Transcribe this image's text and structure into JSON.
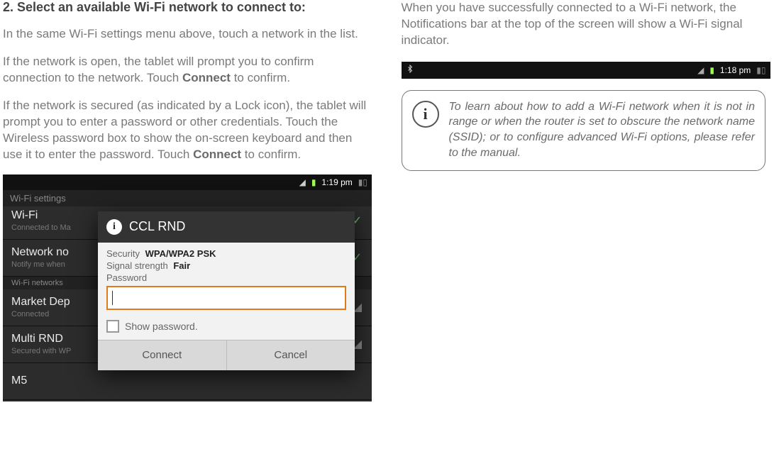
{
  "left": {
    "step_header": "2.   Select an available Wi-Fi network to connect to:",
    "p1": "In the same Wi-Fi settings menu above, touch a network in the list.",
    "p2a": "If the network is open, the tablet will prompt you to confirm connection to the network. Touch ",
    "p2_connect": "Connect",
    "p2b": " to confirm.",
    "p3a": "If the network is secured (as indicated by a Lock icon), the tablet will prompt you to enter a password or other credentials.  Touch the Wireless password box to show the on-screen keyboard and then use it to enter the password. Touch ",
    "p3_connect": "Connect",
    "p3b": " to confirm."
  },
  "fig1": {
    "statusbar_time": "1:19 pm",
    "settings_header": "Wi-Fi settings",
    "rows": {
      "wifi_title": "Wi-Fi",
      "wifi_sub": "Connected to Ma",
      "netnotif_title": "Network no",
      "netnotif_sub": "Notify me when",
      "section": "Wi-Fi networks",
      "marketdep_title": "Market Dep",
      "marketdep_sub": "Connected",
      "multirnd_title": "Multi RND",
      "multirnd_sub": "Secured with WP",
      "m5_title": "M5"
    },
    "dialog": {
      "title": "CCL RND",
      "sec_label": "Security",
      "sec_value": "WPA/WPA2 PSK",
      "sig_label": "Signal strength",
      "sig_value": "Fair",
      "pw_label": "Password",
      "showpw": "Show password.",
      "btn_connect": "Connect",
      "btn_cancel": "Cancel"
    }
  },
  "right": {
    "p1": "When you have successfully connected to a Wi-Fi network, the Notifications bar at the top of the screen will show a Wi-Fi signal indicator."
  },
  "fig2": {
    "time": "1:18 pm"
  },
  "note": {
    "text": "To learn about how to add a Wi-Fi network when it is not in range or when the router is set to obscure the network name (SSID); or to configure advanced Wi-Fi options, please refer to the manual."
  }
}
